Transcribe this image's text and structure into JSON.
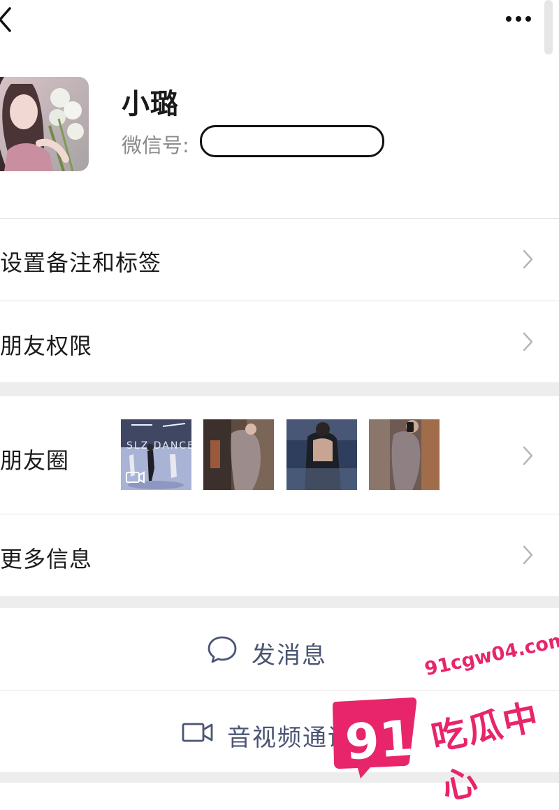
{
  "profile": {
    "name": "小璐",
    "wechat_id_label": "微信号:"
  },
  "menu": {
    "remark_label": "设置备注和标签",
    "permissions_label": "朋友权限",
    "moments_label": "朋友圈",
    "more_info_label": "更多信息"
  },
  "moments": {
    "thumbnails": [
      {
        "kind": "video",
        "overlay_text": "SLZ DANCE",
        "icon": "video-camera-icon"
      },
      {
        "kind": "photo"
      },
      {
        "kind": "photo"
      },
      {
        "kind": "photo"
      }
    ]
  },
  "actions": {
    "message_label": "发消息",
    "call_label": "音视频通话"
  },
  "watermark": {
    "number": "91",
    "url": "91cgw04.com",
    "name": "吃瓜中心"
  },
  "colors": {
    "action_text": "#4b5573",
    "divider_band": "#ededed",
    "watermark": "#e8256a"
  },
  "icons": {
    "back": "back-chevron-icon",
    "more": "more-dots-icon",
    "row_arrow": "chevron-right-icon",
    "message": "chat-bubble-icon",
    "call": "video-camera-icon"
  }
}
